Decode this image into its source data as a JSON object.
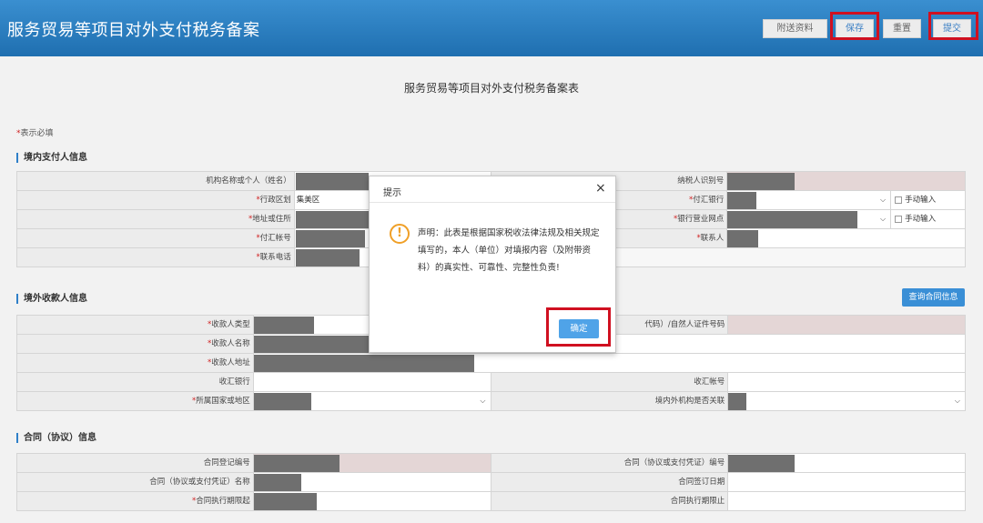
{
  "header": {
    "title": "服务贸易等项目对外支付税务备案",
    "buttons": {
      "attach": "附送资料",
      "save": "保存",
      "reset": "重置",
      "submit": "提交"
    }
  },
  "form": {
    "title": "服务贸易等项目对外支付税务备案表",
    "required_note": "表示必填",
    "manual_input": "手动输入",
    "query_contract_btn": "查询合同信息"
  },
  "payer": {
    "section_title": "境内支付人信息",
    "org_name_label": "机构名称或个人（姓名）",
    "taxpayer_id_label": "纳税人识别号",
    "district_label": "行政区划",
    "district_value": "集美区",
    "pay_bank_label": "付汇银行",
    "address_label": "地址或住所",
    "bank_branch_label": "银行营业网点",
    "account_label": "付汇帐号",
    "contact_label": "联系人",
    "phone_label": "联系电话"
  },
  "payee": {
    "section_title": "境外收款人信息",
    "type_label": "收款人类型",
    "id_label_fragment": "代码）/自然人证件号码",
    "name_label": "收款人名称",
    "address_label": "收款人地址",
    "bank_label": "收汇银行",
    "account_label": "收汇帐号",
    "country_label": "所属国家或地区",
    "related_label": "境内外机构是否关联"
  },
  "contract": {
    "section_title": "合同（协议）信息",
    "reg_no_label": "合同登记编号",
    "contract_no_label": "合同（协议或支付凭证）编号",
    "name_label": "合同（协议或支付凭证）名称",
    "sign_date_label": "合同签订日期",
    "start_label": "合同执行期限起",
    "end_label": "合同执行期限止"
  },
  "dialog": {
    "title": "提示",
    "close": "×",
    "message": "声明：此表是根据国家税收法律法规及相关规定填写的，本人（单位）对填报内容（及附带资料）的真实性、可靠性、完整性负责!",
    "ok": "确定",
    "icon": "warning-icon"
  },
  "colors": {
    "header_blue": "#1f6fb0",
    "highlight_red": "#d01020",
    "ok_button": "#4fa3e8",
    "required_star": "#d02020"
  }
}
